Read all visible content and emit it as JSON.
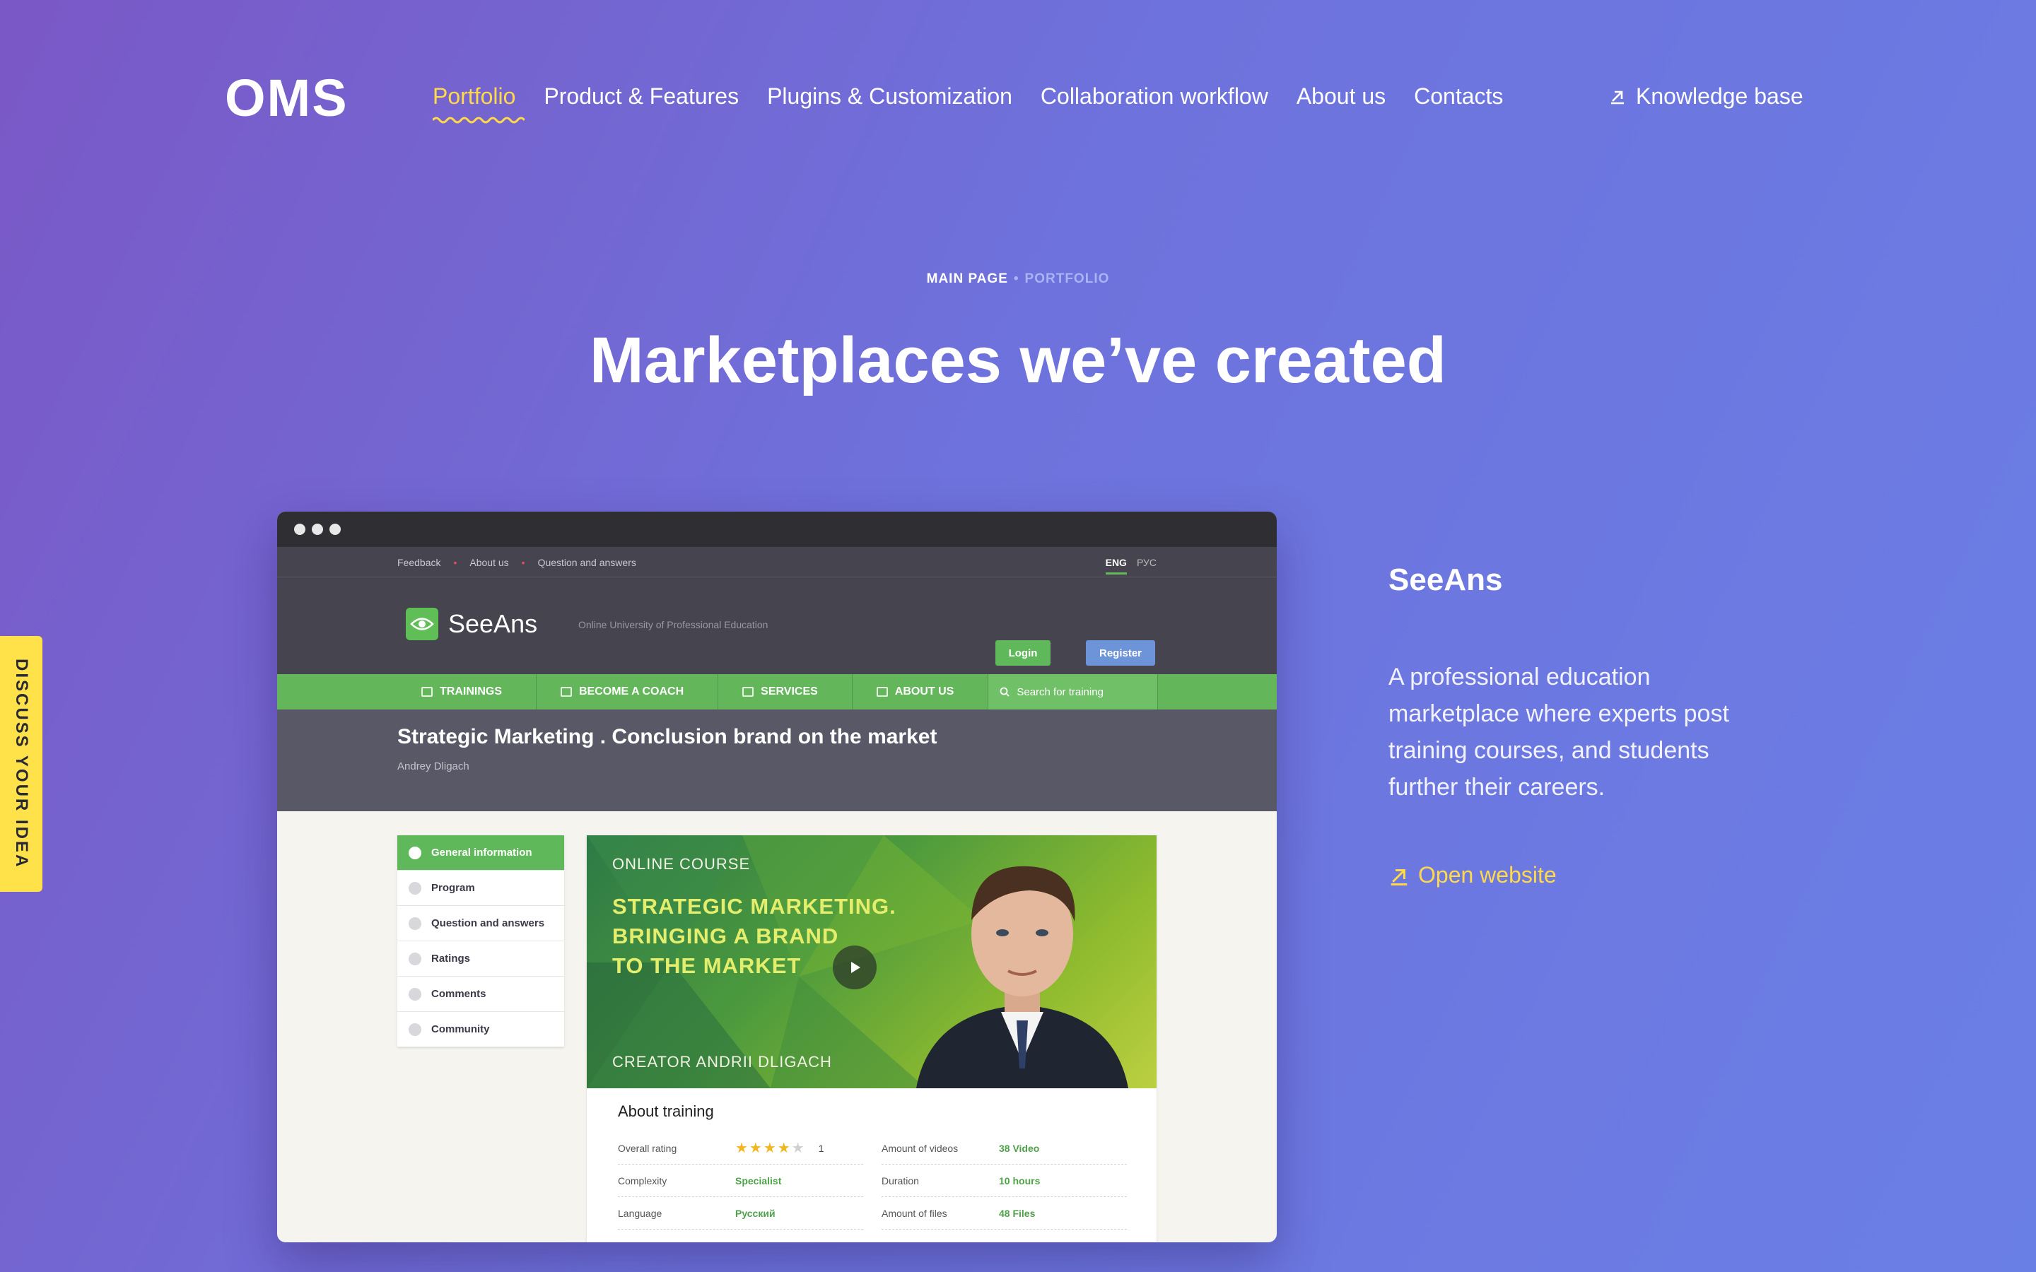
{
  "header": {
    "logo": "OMS",
    "nav": [
      {
        "label": "Portfolio"
      },
      {
        "label": "Product & Features"
      },
      {
        "label": "Plugins & Customization"
      },
      {
        "label": "Collaboration workflow"
      },
      {
        "label": "About us"
      },
      {
        "label": "Contacts"
      }
    ],
    "knowledge_base": "Knowledge base",
    "active_color": "#ffd94a"
  },
  "breadcrumb": {
    "main": "MAIN PAGE",
    "separator": "•",
    "current": "PORTFOLIO"
  },
  "page_title": "Marketplaces we’ve created",
  "side_tab": "DISCUSS YOUR IDEA",
  "preview": {
    "topnav": [
      "Feedback",
      "About us",
      "Question and answers"
    ],
    "lang": {
      "eng": "ENG",
      "rus": "РУС"
    },
    "site_name": "SeeAns",
    "tagline": "Online University of Professional Education",
    "login": "Login",
    "register": "Register",
    "menu": [
      "TRAININGS",
      "BECOME A COACH",
      "SERVICES",
      "ABOUT US"
    ],
    "search_placeholder": "Search for training",
    "hero_title": "Strategic Marketing . Conclusion brand on the market",
    "hero_author": "Andrey Dligach",
    "sidebar": [
      "General information",
      "Program",
      "Question and answers",
      "Ratings",
      "Comments",
      "Community"
    ],
    "course": {
      "kicker": "ONLINE COURSE",
      "heading_lines": [
        "STRATEGIC MARKETING.",
        "BRINGING A BRAND",
        "TO THE MARKET"
      ],
      "creator": "CREATOR ANDRII DLIGACH"
    },
    "about": {
      "title": "About training",
      "rating_label": "Overall rating",
      "rating_value": 4,
      "rating_max": 5,
      "rating_count": "1",
      "rows": [
        {
          "k": "Amount of videos",
          "v": "38 Video"
        },
        {
          "k": "Complexity",
          "v": "Specialist"
        },
        {
          "k": "Duration",
          "v": "10 hours"
        },
        {
          "k": "Language",
          "v": "Русский"
        },
        {
          "k": "Amount of files",
          "v": "48 Files"
        }
      ]
    }
  },
  "project": {
    "name": "SeeAns",
    "description": "A professional education marketplace where experts post training courses, and students further their careers.",
    "open_link": "Open website"
  },
  "colors": {
    "accent": "#ffd94a",
    "brand_green": "#5fb85a",
    "side_tab": "#ffe14a"
  }
}
